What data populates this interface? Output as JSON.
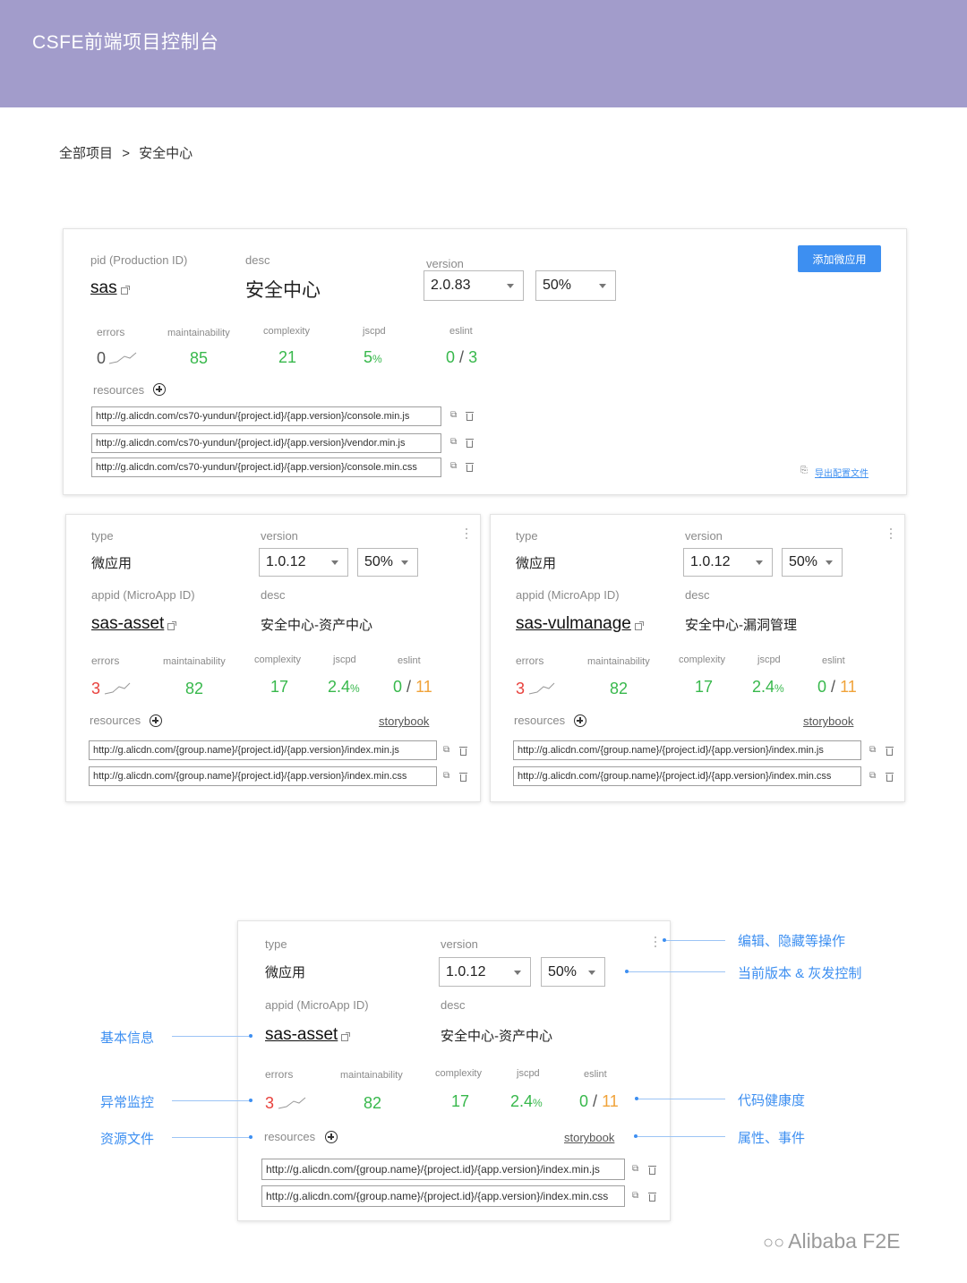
{
  "header": {
    "title": "CSFE前端项目控制台"
  },
  "breadcrumb": {
    "root": "全部项目",
    "separator": ">",
    "current": "安全中心"
  },
  "project": {
    "pid_label": "pid (Production ID)",
    "pid": "sas",
    "desc_label": "desc",
    "desc": "安全中心",
    "version_label": "version",
    "version": "2.0.83",
    "gray": "50%",
    "add_button": "添加微应用",
    "metrics": {
      "errors_label": "errors",
      "errors": "0",
      "maintainability_label": "maintainability",
      "maintainability": "85",
      "complexity_label": "complexity",
      "complexity": "21",
      "jscpd_label": "jscpd",
      "jscpd": "5",
      "jscpd_unit": "%",
      "eslint_label": "eslint",
      "eslint_a": "0",
      "eslint_sep": "/",
      "eslint_b": "3"
    },
    "resources_label": "resources",
    "resources": [
      "http://g.alicdn.com/cs70-yundun/{project.id}/{app.version}/console.min.js",
      "http://g.alicdn.com/cs70-yundun/{project.id}/{app.version}/vendor.min.js",
      "http://g.alicdn.com/cs70-yundun/{project.id}/{app.version}/console.min.css"
    ],
    "export_link": "导出配置文件"
  },
  "apps": [
    {
      "type_label": "type",
      "type": "微应用",
      "version_label": "version",
      "version": "1.0.12",
      "gray": "50%",
      "appid_label": "appid (MicroApp ID)",
      "appid": "sas-asset",
      "desc_label": "desc",
      "desc": "安全中心-资产中心",
      "errors_label": "errors",
      "errors": "3",
      "maintainability_label": "maintainability",
      "maintainability": "82",
      "complexity_label": "complexity",
      "complexity": "17",
      "jscpd_label": "jscpd",
      "jscpd": "2.4",
      "jscpd_unit": "%",
      "eslint_label": "eslint",
      "eslint_a": "0",
      "eslint_sep": "/",
      "eslint_b": "11",
      "resources_label": "resources",
      "storybook": "storybook",
      "resources": [
        "http://g.alicdn.com/{group.name}/{project.id}/{app.version}/index.min.js",
        "http://g.alicdn.com/{group.name}/{project.id}/{app.version}/index.min.css"
      ]
    },
    {
      "type_label": "type",
      "type": "微应用",
      "version_label": "version",
      "version": "1.0.12",
      "gray": "50%",
      "appid_label": "appid (MicroApp ID)",
      "appid": "sas-vulmanage",
      "desc_label": "desc",
      "desc": "安全中心-漏洞管理",
      "errors_label": "errors",
      "errors": "3",
      "maintainability_label": "maintainability",
      "maintainability": "82",
      "complexity_label": "complexity",
      "complexity": "17",
      "jscpd_label": "jscpd",
      "jscpd": "2.4",
      "jscpd_unit": "%",
      "eslint_label": "eslint",
      "eslint_a": "0",
      "eslint_sep": "/",
      "eslint_b": "11",
      "resources_label": "resources",
      "storybook": "storybook",
      "resources": [
        "http://g.alicdn.com/{group.name}/{project.id}/{app.version}/index.min.js",
        "http://g.alicdn.com/{group.name}/{project.id}/{app.version}/index.min.css"
      ]
    }
  ],
  "detail": {
    "type_label": "type",
    "type": "微应用",
    "version_label": "version",
    "version": "1.0.12",
    "gray": "50%",
    "appid_label": "appid (MicroApp ID)",
    "appid": "sas-asset",
    "desc_label": "desc",
    "desc": "安全中心-资产中心",
    "errors_label": "errors",
    "errors": "3",
    "maintainability_label": "maintainability",
    "maintainability": "82",
    "complexity_label": "complexity",
    "complexity": "17",
    "jscpd_label": "jscpd",
    "jscpd": "2.4",
    "jscpd_unit": "%",
    "eslint_label": "eslint",
    "eslint_a": "0",
    "eslint_sep": "/",
    "eslint_b": "11",
    "resources_label": "resources",
    "storybook": "storybook",
    "resources": [
      "http://g.alicdn.com/{group.name}/{project.id}/{app.version}/index.min.js",
      "http://g.alicdn.com/{group.name}/{project.id}/{app.version}/index.min.css"
    ]
  },
  "annotations": {
    "edit_hide": "编辑、隐藏等操作",
    "version_gray": "当前版本 & 灰发控制",
    "basic_info": "基本信息",
    "error_monitor": "异常监控",
    "resource_files": "资源文件",
    "code_health": "代码健康度",
    "props_events": "属性、事件"
  },
  "watermark": "Alibaba F2E",
  "colors": {
    "header": "#a29ccb",
    "primary": "#3d8ff1",
    "good": "#38b84c",
    "bad": "#e8413c",
    "warn": "#f0a33a"
  }
}
